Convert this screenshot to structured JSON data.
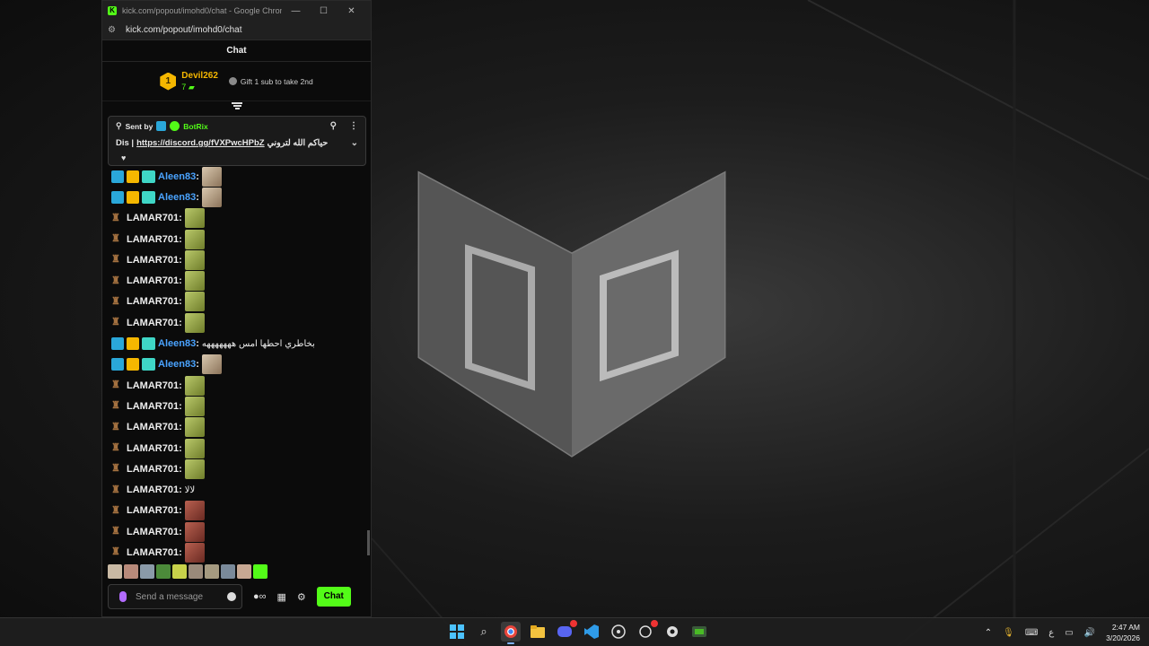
{
  "window": {
    "title": "kick.com/popout/imohd0/chat - Google Chrome",
    "address": "kick.com/popout/imohd0/chat",
    "favicon": "K",
    "controls": [
      "—",
      "☐",
      "✕"
    ]
  },
  "chat": {
    "header": "Chat",
    "leader": {
      "rank": "1",
      "name": "Devil262",
      "count": "7",
      "gift_text": "Gift 1 sub to take 2nd"
    },
    "pinned": {
      "sent_by": "Sent by",
      "sender": "BotRix",
      "prefix": "Dis |",
      "link": "https://discord.gg/fVXPwcHPbZ",
      "arabic": "حياكم الله لتروني"
    },
    "messages": [
      {
        "user": "Aleen83",
        "type": "aleen",
        "emote": "face"
      },
      {
        "user": "Aleen83",
        "type": "aleen",
        "emote": "face"
      },
      {
        "user": "LAMAR701",
        "type": "lamar",
        "emote": "green"
      },
      {
        "user": "LAMAR701",
        "type": "lamar",
        "emote": "green"
      },
      {
        "user": "LAMAR701",
        "type": "lamar",
        "emote": "green"
      },
      {
        "user": "LAMAR701",
        "type": "lamar",
        "emote": "green"
      },
      {
        "user": "LAMAR701",
        "type": "lamar",
        "emote": "green"
      },
      {
        "user": "LAMAR701",
        "type": "lamar",
        "emote": "green"
      },
      {
        "user": "Aleen83",
        "type": "aleen",
        "text": "بخاطري احطها امس هههههههه"
      },
      {
        "user": "Aleen83",
        "type": "aleen",
        "emote": "face"
      },
      {
        "user": "LAMAR701",
        "type": "lamar",
        "emote": "green"
      },
      {
        "user": "LAMAR701",
        "type": "lamar",
        "emote": "green"
      },
      {
        "user": "LAMAR701",
        "type": "lamar",
        "emote": "green"
      },
      {
        "user": "LAMAR701",
        "type": "lamar",
        "emote": "green"
      },
      {
        "user": "LAMAR701",
        "type": "lamar",
        "emote": "green"
      },
      {
        "user": "LAMAR701",
        "type": "lamar",
        "text": "لالا"
      },
      {
        "user": "LAMAR701",
        "type": "lamar",
        "emote": "red"
      },
      {
        "user": "LAMAR701",
        "type": "lamar",
        "emote": "red"
      },
      {
        "user": "LAMAR701",
        "type": "lamar",
        "emote": "red"
      }
    ],
    "quick_emotes": [
      "#c9b9a4",
      "#b88a7a",
      "#8a9aa8",
      "#4c8a3a",
      "#c8d24a",
      "#9a8a7a",
      "#a59a80",
      "#7a8a9a",
      "#c7a893",
      "#53fc18"
    ],
    "input_placeholder": "Send a message",
    "send_label": "Chat"
  },
  "taskbar": {
    "apps": [
      "windows-start",
      "search",
      "chrome",
      "file-explorer",
      "discord",
      "vscode",
      "obs",
      "app-red",
      "steam",
      "gamebar"
    ],
    "time": "2:47 AM",
    "date": "3/20/2026",
    "lang": "ع"
  },
  "colors": {
    "kick_green": "#53fc18",
    "leader_gold": "#f5b700",
    "aleen_blue": "#4aa3ff"
  }
}
